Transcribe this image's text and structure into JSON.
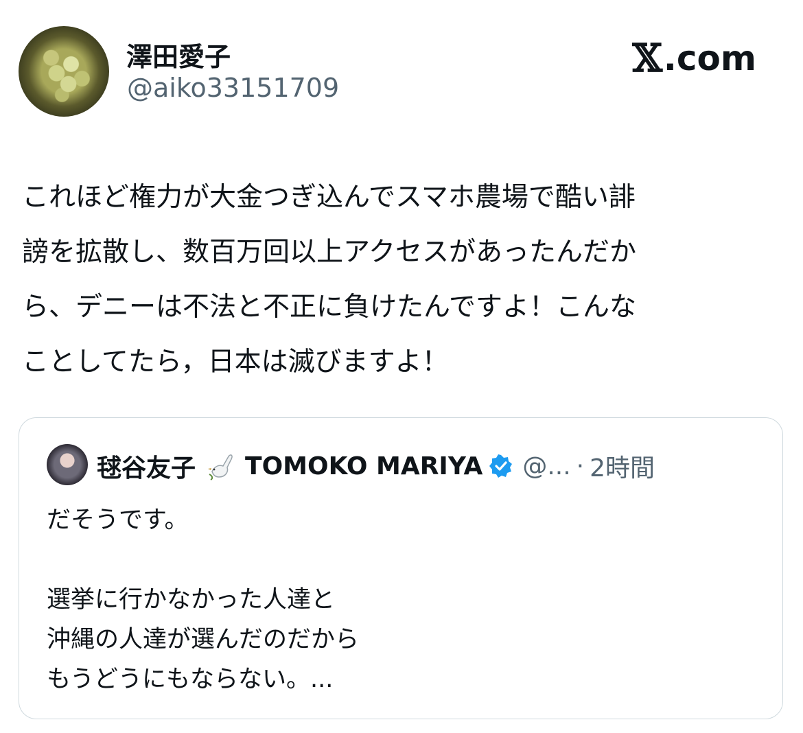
{
  "post": {
    "author_name": "澤田愛子",
    "author_handle": "@aiko33151709",
    "avatar_icon": "grape-cluster-avatar",
    "brand": {
      "icon": "x-logo-icon",
      "glyph": "𝕏",
      "text": ".com"
    },
    "body": "これほど権力が大金つぎ込んでスマホ農場で酷い誹\n謗を拡散し、数百万回以上アクセスがあったんだか\nら、デニーは不法と不正に負けたんですよ！こんな\nことしてたら，日本は滅びますよ！"
  },
  "quote": {
    "author_name": "毬谷友子",
    "dove_icon": "dove-icon",
    "display_name_en": "TOMOKO MARIYA",
    "verified_icon": "verified-badge-icon",
    "handle": "@...",
    "separator": "·",
    "time": "2時間",
    "body": "だそうです。\n\n選挙に行かなかった人達と\n沖縄の人達が選んだのだから\nもうどうにもならない。..."
  },
  "colors": {
    "text": "#0f1419",
    "secondary": "#536471",
    "border": "#cfd9de",
    "verified": "#1d9bf0"
  }
}
